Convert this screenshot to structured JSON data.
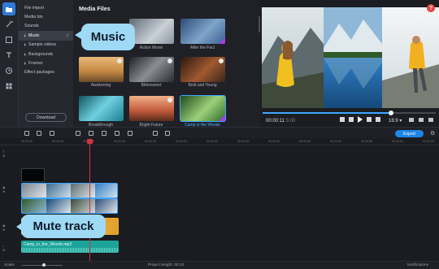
{
  "sidebar": {
    "items": [
      {
        "label": "File import",
        "arrow": false,
        "selected": false,
        "badge": ""
      },
      {
        "label": "Media bin",
        "arrow": false,
        "selected": false,
        "badge": ""
      },
      {
        "label": "Sounds",
        "arrow": false,
        "selected": false,
        "badge": ""
      },
      {
        "label": "Music",
        "arrow": true,
        "selected": true,
        "badge": "⇩"
      },
      {
        "label": "Sample videos",
        "arrow": true,
        "selected": false,
        "badge": ""
      },
      {
        "label": "Backgrounds",
        "arrow": true,
        "selected": false,
        "badge": ""
      },
      {
        "label": "Frames",
        "arrow": true,
        "selected": false,
        "badge": ""
      },
      {
        "label": "Effect packages",
        "arrow": false,
        "selected": false,
        "badge": ""
      }
    ],
    "download_label": "Download"
  },
  "media": {
    "title": "Media Files",
    "items": [
      {
        "caption": "Action Movie",
        "colors": [
          "#7a8590",
          "#c9d0d6"
        ]
      },
      {
        "caption": "After the Fact",
        "colors": [
          "#3a5f8f",
          "#7fa4c9"
        ]
      },
      {
        "caption": "Awakening",
        "colors": [
          "#c88a45",
          "#f0c080"
        ]
      },
      {
        "caption": "Bittersweet",
        "colors": [
          "#2a2c30",
          "#8a8d92"
        ]
      },
      {
        "caption": "Bold and Young",
        "colors": [
          "#3a2418",
          "#a05a30"
        ]
      },
      {
        "caption": "Breakthrough",
        "colors": [
          "#1a7f8f",
          "#6fd0e0"
        ]
      },
      {
        "caption": "Bright Future",
        "colors": [
          "#c0583a",
          "#f2b088"
        ]
      },
      {
        "caption": "Camp in the Woods",
        "colors": [
          "#2e6a2a",
          "#9dd07a"
        ]
      }
    ]
  },
  "callouts": {
    "music": "Music",
    "mute": "Mute track"
  },
  "preview": {
    "time_current": "00:00:11",
    "time_total": "5:00",
    "progress": 0.74,
    "aspect": "16:9 ▾",
    "help": "?"
  },
  "toolbar": {
    "export_label": "Export",
    "gear": "⚙"
  },
  "timeline": {
    "ruler": [
      "00:00:00",
      "00:00:05",
      "00:00:10",
      "00:00:15",
      "00:00:20",
      "00:00:25",
      "00:00:30",
      "00:00:35",
      "00:00:40",
      "00:00:45",
      "00:00:50",
      "00:00:55",
      "00:01:00",
      "00:01:05"
    ],
    "audio_clip_label": "Camp_in_the_Woods.mp3"
  },
  "status": {
    "scale_label": "Scale:",
    "project_length_label": "Project length:",
    "project_length_value": "00:13",
    "notifications_label": "Notifications"
  },
  "colors": {
    "accent": "#1e86e6",
    "callout": "#9ed9f5",
    "playhead": "#d6343f",
    "audio": "#1ea39a"
  }
}
